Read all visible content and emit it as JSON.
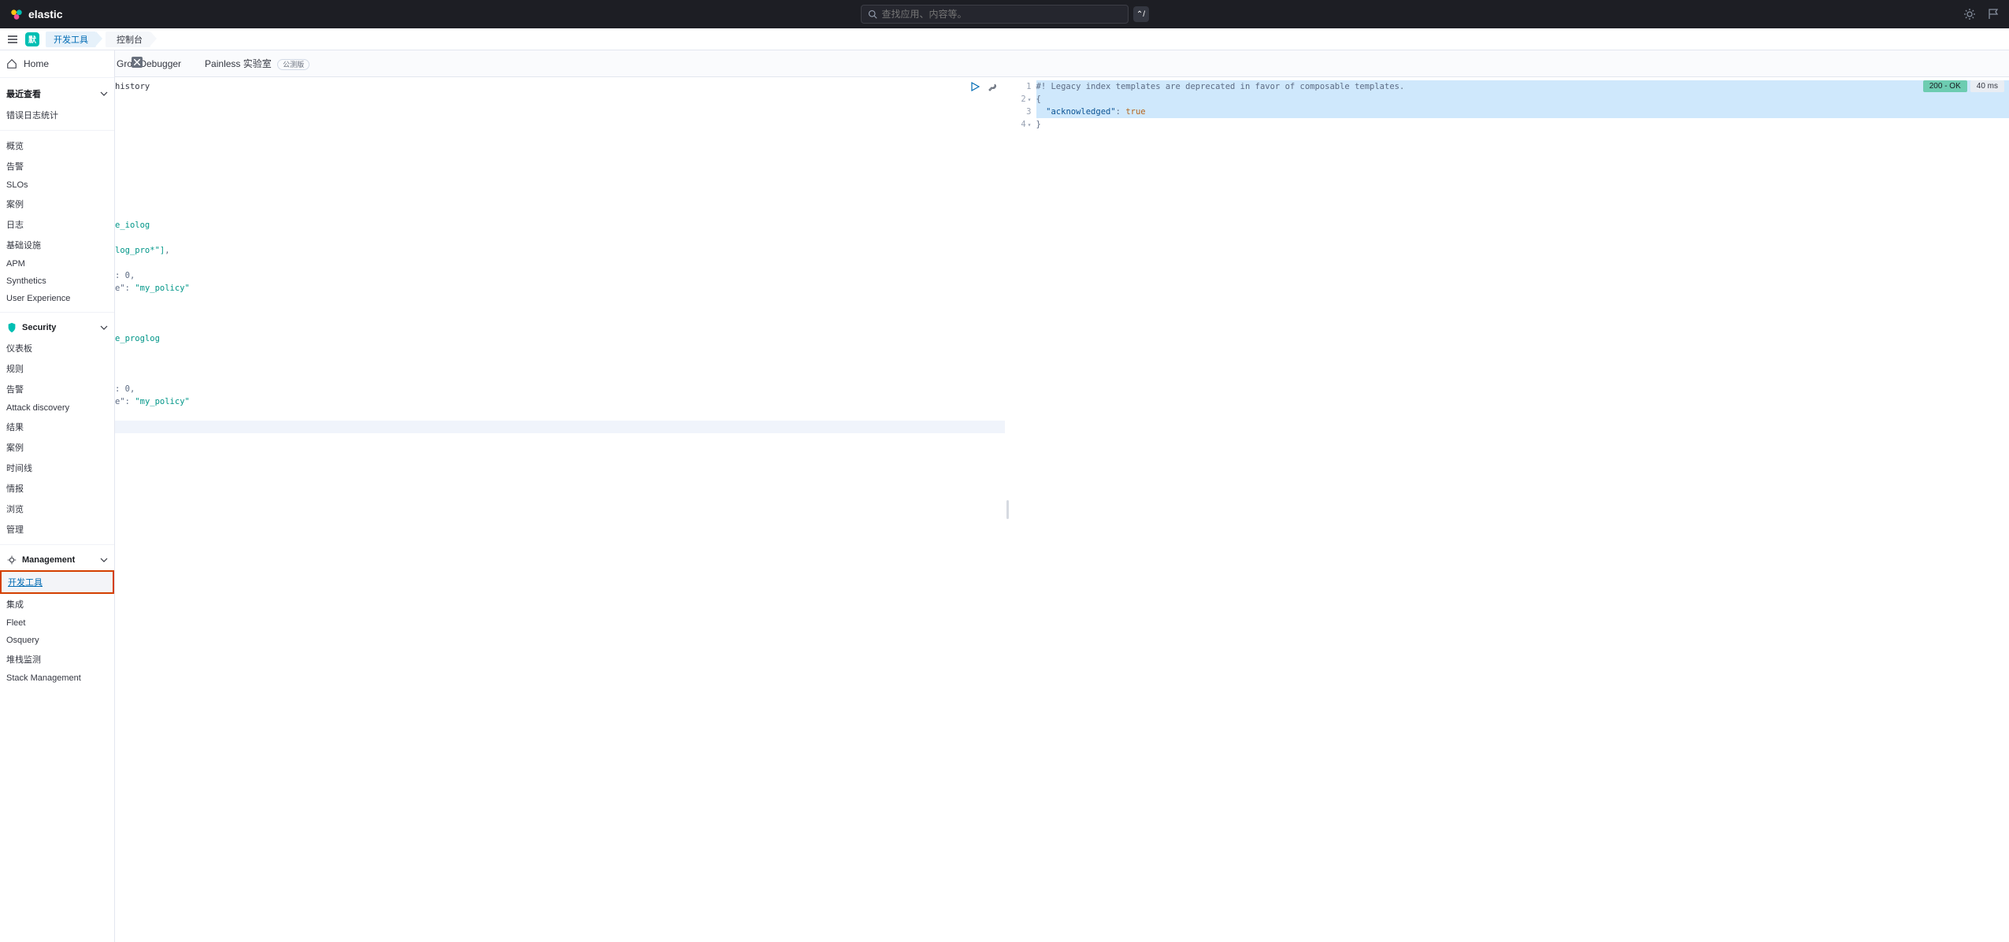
{
  "header": {
    "brand": "elastic",
    "search_placeholder": "查找应用、内容等。",
    "kbd": "⌃/"
  },
  "breadcrumb": {
    "space": "默",
    "app": "开发工具",
    "page": "控制台"
  },
  "sidenav": {
    "home": "Home",
    "recent_header": "最近查看",
    "recent_item": "错误日志统计",
    "observability_header": "",
    "observability_items": [
      "概览",
      "告警",
      "SLOs",
      "案例",
      "日志",
      "基础设施",
      "APM",
      "Synthetics",
      "User Experience"
    ],
    "security_header": "Security",
    "security_items": [
      "仪表板",
      "规则",
      "告警",
      "Attack discovery",
      "结果",
      "案例",
      "时间线",
      "情报",
      "浏览",
      "管理"
    ],
    "management_header": "Management",
    "management_items": [
      "开发工具",
      "集成",
      "Fleet",
      "Osquery",
      "堆栈监测",
      "Stack Management"
    ]
  },
  "tabs": {
    "grok": "Grok Debugger",
    "painless": "Painless 实验室",
    "beta": "公测版"
  },
  "request": {
    "history_line": "history",
    "template1_name": "e_iolog",
    "template1_pattern": "log_pro*\"]",
    "refresh_line": ": 0,",
    "policy_line": "e\": \"my_policy\"",
    "template2_name": "e_proglog",
    "refresh_line2": ": 0,",
    "policy_line2": "e\": \"my_policy\""
  },
  "response": {
    "status": "200 - OK",
    "time": "40 ms",
    "line1": "#! Legacy index templates are deprecated in favor of composable templates.",
    "line2": "{",
    "line3_key": "\"acknowledged\"",
    "line3_val": "true",
    "line4": "}",
    "gutter": [
      "1",
      "2",
      "3",
      "4"
    ]
  }
}
